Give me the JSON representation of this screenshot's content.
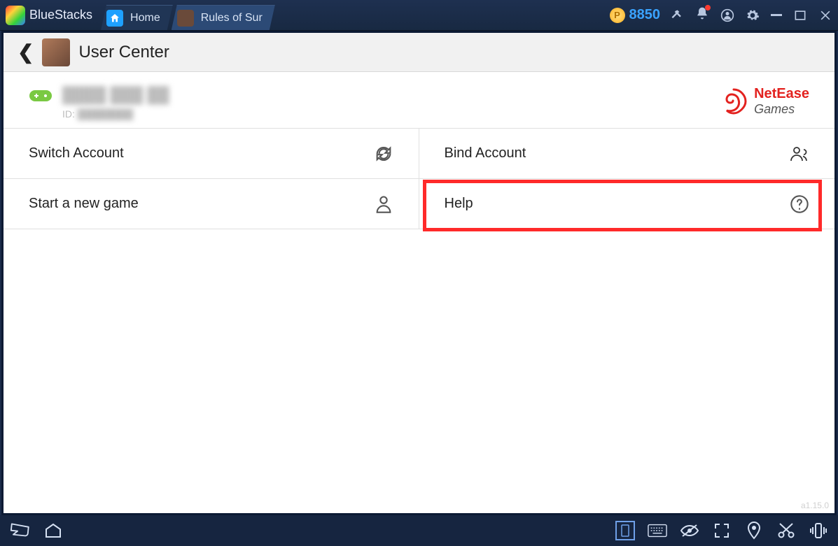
{
  "window": {
    "brand": "BlueStacks",
    "tabs": [
      {
        "label": "Home",
        "active": false
      },
      {
        "label": "Rules of Sur",
        "active": true
      }
    ],
    "coins": "8850"
  },
  "app": {
    "header_title": "User Center",
    "user": {
      "id_label": "ID:"
    },
    "brand_text1": "NetEase",
    "brand_text2": "Games",
    "options": {
      "switch": "Switch Account",
      "bind": "Bind Account",
      "newgame": "Start a new game",
      "help": "Help"
    },
    "version": "a1.15.0"
  }
}
